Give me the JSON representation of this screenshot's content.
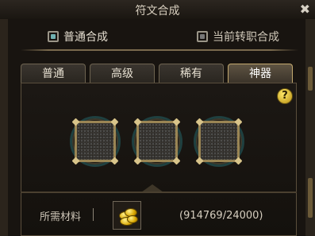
{
  "window": {
    "title": "符文合成",
    "close_glyph": "✖"
  },
  "modes": {
    "normal_label": "普通合成",
    "current_job_label": "当前转职合成"
  },
  "tabs": [
    "普通",
    "高级",
    "稀有",
    "神器"
  ],
  "active_tab": "神器",
  "help": {
    "glyph": "?"
  },
  "slots": {
    "count": 3,
    "state": "empty"
  },
  "material": {
    "label": "所需材料",
    "item_icon": "gold-coins-icon",
    "quantity_text": "(914769/24000)"
  },
  "colors": {
    "accent_gold": "#c2a86e",
    "ring_teal": "#1f4040",
    "help_yellow": "#f2d23c"
  }
}
